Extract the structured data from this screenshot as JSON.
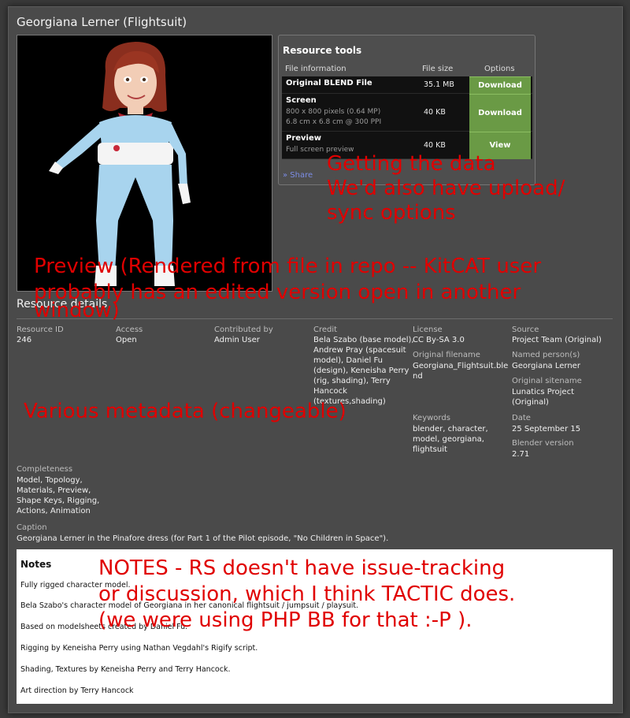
{
  "page": {
    "title": "Georgiana Lerner (Flightsuit)"
  },
  "tools": {
    "title": "Resource tools",
    "headers": {
      "file": "File information",
      "size": "File size",
      "options": "Options"
    },
    "rows": [
      {
        "name": "Original BLEND File",
        "sub1": "",
        "sub2": "",
        "size": "35.1 MB",
        "action": "Download"
      },
      {
        "name": "Screen",
        "sub1": "800 x 800 pixels (0.64 MP)",
        "sub2": "6.8 cm x 6.8 cm @ 300 PPI",
        "size": "40 KB",
        "action": "Download"
      },
      {
        "name": "Preview",
        "sub1": "Full screen preview",
        "sub2": "",
        "size": "40 KB",
        "action": "View"
      }
    ],
    "share": "» Share"
  },
  "annotations": {
    "getting_data": [
      "Getting the data",
      "We'd also have upload/",
      "sync options"
    ],
    "preview": [
      "Preview (Rendered from file in repo -- KitCAT user",
      "probably has an edited version open in another",
      "window)"
    ],
    "metadata": "Various metadata (changeable)",
    "notes": [
      "NOTES - RS doesn't have issue-tracking",
      "or discussion, which I think TACTIC does.",
      "(we were using PHP BB for that :-P )."
    ]
  },
  "details": {
    "title": "Resource details",
    "resource_id": {
      "label": "Resource ID",
      "value": "246"
    },
    "access": {
      "label": "Access",
      "value": "Open"
    },
    "contributed_by": {
      "label": "Contributed by",
      "value": "Admin User"
    },
    "credit": {
      "label": "Credit",
      "lines": [
        "Bela Szabo (base model),",
        "Andrew Pray (spacesuit",
        "model), Daniel Fu",
        "(design), Keneisha Perry",
        "(rig, shading), Terry",
        "Hancock",
        "(textures,shading)"
      ]
    },
    "license": {
      "label": "License",
      "value": "CC By-SA 3.0"
    },
    "original_filename": {
      "label": "Original filename",
      "lines": [
        "Georgiana_Flightsuit.ble",
        "nd"
      ]
    },
    "keywords": {
      "label": "Keywords",
      "lines": [
        "blender, character,",
        "model, georgiana,",
        "flightsuit"
      ]
    },
    "source": {
      "label": "Source",
      "value": "Project Team (Original)"
    },
    "named_persons": {
      "label": "Named person(s)",
      "value": "Georgiana Lerner"
    },
    "original_sitename": {
      "label": "Original sitename",
      "lines": [
        "Lunatics Project",
        "(Original)"
      ]
    },
    "date": {
      "label": "Date",
      "value": "25 September 15"
    },
    "blender_version": {
      "label": "Blender version",
      "value": "2.71"
    },
    "completeness": {
      "label": "Completeness",
      "lines": [
        "Model, Topology,",
        "Materials, Preview,",
        "Shape Keys, Rigging,",
        "Actions, Animation"
      ]
    },
    "caption": {
      "label": "Caption",
      "value": "Georgiana Lerner in the Pinafore dress (for Part 1 of the Pilot episode, \"No Children in Space\")."
    }
  },
  "notes": {
    "title": "Notes",
    "lines": [
      "Fully rigged character model.",
      "Bela Szabo's character model of Georgiana in her canonical flightsuit / jumpsuit / playsuit.",
      "Based on modelsheets created by Daniel Fu.",
      "Rigging by Keneisha Perry using Nathan Vegdahl's Rigify script.",
      "Shading, Textures by Keneisha Perry and Terry Hancock.",
      "Art direction by Terry Hancock"
    ]
  },
  "colors": {
    "annotation": "#e00000",
    "download_button": "#6a9a45",
    "share_link": "#7c8de6"
  }
}
